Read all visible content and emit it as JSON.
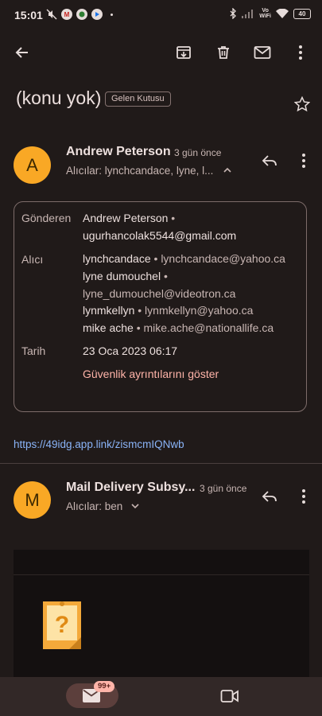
{
  "status_bar": {
    "time": "15:01",
    "volte_top": "Vo",
    "volte_bottom": "WiFi",
    "battery": "40"
  },
  "toolbar": {
    "back_icon": "arrow-left-icon",
    "archive_icon": "archive-icon",
    "delete_icon": "trash-icon",
    "mark_unread_icon": "envelope-icon",
    "more_icon": "more-vert-icon"
  },
  "subject": {
    "title": "(konu yok)",
    "label": "Gelen Kutusu",
    "star_icon": "star-outline-icon"
  },
  "messages": [
    {
      "avatar_letter": "A",
      "sender": "Andrew Peterson",
      "time": "3 gün önce",
      "recipients": "Alıcılar: lynchcandace, lyne, l...",
      "details": {
        "from_label": "Gönderen",
        "from_name": "Andrew Peterson",
        "from_email": "ugurhancolak5544@gmail.com",
        "to_label": "Alıcı",
        "to": [
          {
            "name": "lynchcandace",
            "email": "lynchcandace@yahoo.ca"
          },
          {
            "name": "lyne dumouchel",
            "email": "lyne_dumouchel@videotron.ca"
          },
          {
            "name": "lynmkellyn",
            "email": "lynmkellyn@yahoo.ca"
          },
          {
            "name": "mike ache",
            "email": "mike.ache@nationallife.ca"
          }
        ],
        "date_label": "Tarih",
        "date": "23 Oca 2023 06:17",
        "security_link": "Güvenlik ayrıntılarını göster"
      },
      "body_link": "https://49idg.app.link/zismcmIQNwb"
    },
    {
      "avatar_letter": "M",
      "sender": "Mail Delivery Subsy...",
      "time": "3 gün önce",
      "recipients": "Alıcılar: ben"
    }
  ],
  "bottom_nav": {
    "mail_badge": "99+"
  },
  "colors": {
    "background": "#201a19",
    "avatar": "#f9a825",
    "link": "#8ab4f8",
    "security_link": "#ffb4a9"
  }
}
